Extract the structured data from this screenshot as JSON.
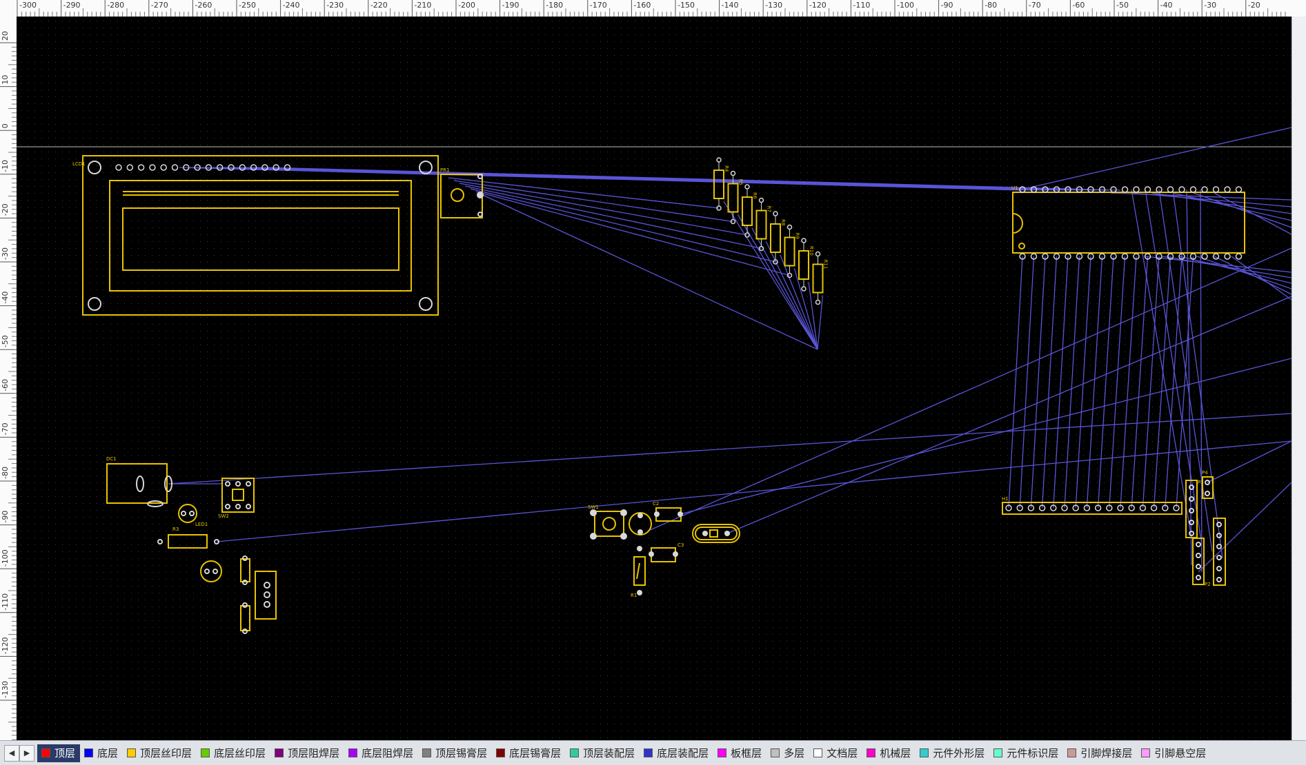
{
  "ruler": {
    "top_labels": [
      "-300",
      "-290",
      "-280",
      "-270",
      "-260",
      "-250",
      "-240",
      "-230",
      "-220",
      "-210",
      "-200",
      "-190",
      "-180",
      "-170",
      "-160",
      "-150",
      "-140",
      "-130",
      "-120",
      "-110",
      "-100",
      "-90",
      "-80",
      "-70",
      "-60",
      "-50",
      "-40",
      "-30",
      "-20"
    ],
    "left_labels": [
      "20",
      "10",
      "0",
      "-10",
      "-20",
      "-30",
      "-40",
      "-50",
      "-60",
      "-70",
      "-80",
      "-90",
      "-100",
      "-110",
      "-120",
      "-130"
    ]
  },
  "components": {
    "lcd": "LCD1",
    "pot": "PR1",
    "resistors": [
      "R4",
      "R5",
      "R6",
      "R7",
      "R8",
      "R9",
      "R10",
      "R11"
    ],
    "mcu": "U1",
    "header_h1": "H1",
    "dc": "DC1",
    "sw2": "SW2",
    "r3": "R3",
    "led": "LED1",
    "sw1": "SW1",
    "c2": "C2",
    "c3": "C3",
    "r1": "R1",
    "right_parts": [
      "P4",
      "P3",
      "P2"
    ]
  },
  "layers": [
    {
      "label": "顶层",
      "color": "#ff0000",
      "active": true
    },
    {
      "label": "底层",
      "color": "#0000ff",
      "active": false
    },
    {
      "label": "顶层丝印层",
      "color": "#ffcc00",
      "active": false
    },
    {
      "label": "底层丝印层",
      "color": "#66cc00",
      "active": false
    },
    {
      "label": "顶层阻焊层",
      "color": "#800080",
      "active": false
    },
    {
      "label": "底层阻焊层",
      "color": "#aa00ff",
      "active": false
    },
    {
      "label": "顶层锡膏层",
      "color": "#808080",
      "active": false
    },
    {
      "label": "底层锡膏层",
      "color": "#800000",
      "active": false
    },
    {
      "label": "顶层装配层",
      "color": "#33cc99",
      "active": false
    },
    {
      "label": "底层装配层",
      "color": "#3333cc",
      "active": false
    },
    {
      "label": "板框层",
      "color": "#ff00ff",
      "active": false
    },
    {
      "label": "多层",
      "color": "#c0c0c0",
      "active": false
    },
    {
      "label": "文档层",
      "color": "#ffffff",
      "active": false
    },
    {
      "label": "机械层",
      "color": "#ff00cc",
      "active": false
    },
    {
      "label": "元件外形层",
      "color": "#33cccc",
      "active": false
    },
    {
      "label": "元件标识层",
      "color": "#66ffcc",
      "active": false
    },
    {
      "label": "引脚焊接层",
      "color": "#cc9999",
      "active": false
    },
    {
      "label": "引脚悬空层",
      "color": "#ff99ff",
      "active": false
    }
  ],
  "colors": {
    "silk": "#e8c400",
    "ratsnest": "#5a55d8",
    "pad": "#d8d8d8",
    "board": "#000000"
  }
}
